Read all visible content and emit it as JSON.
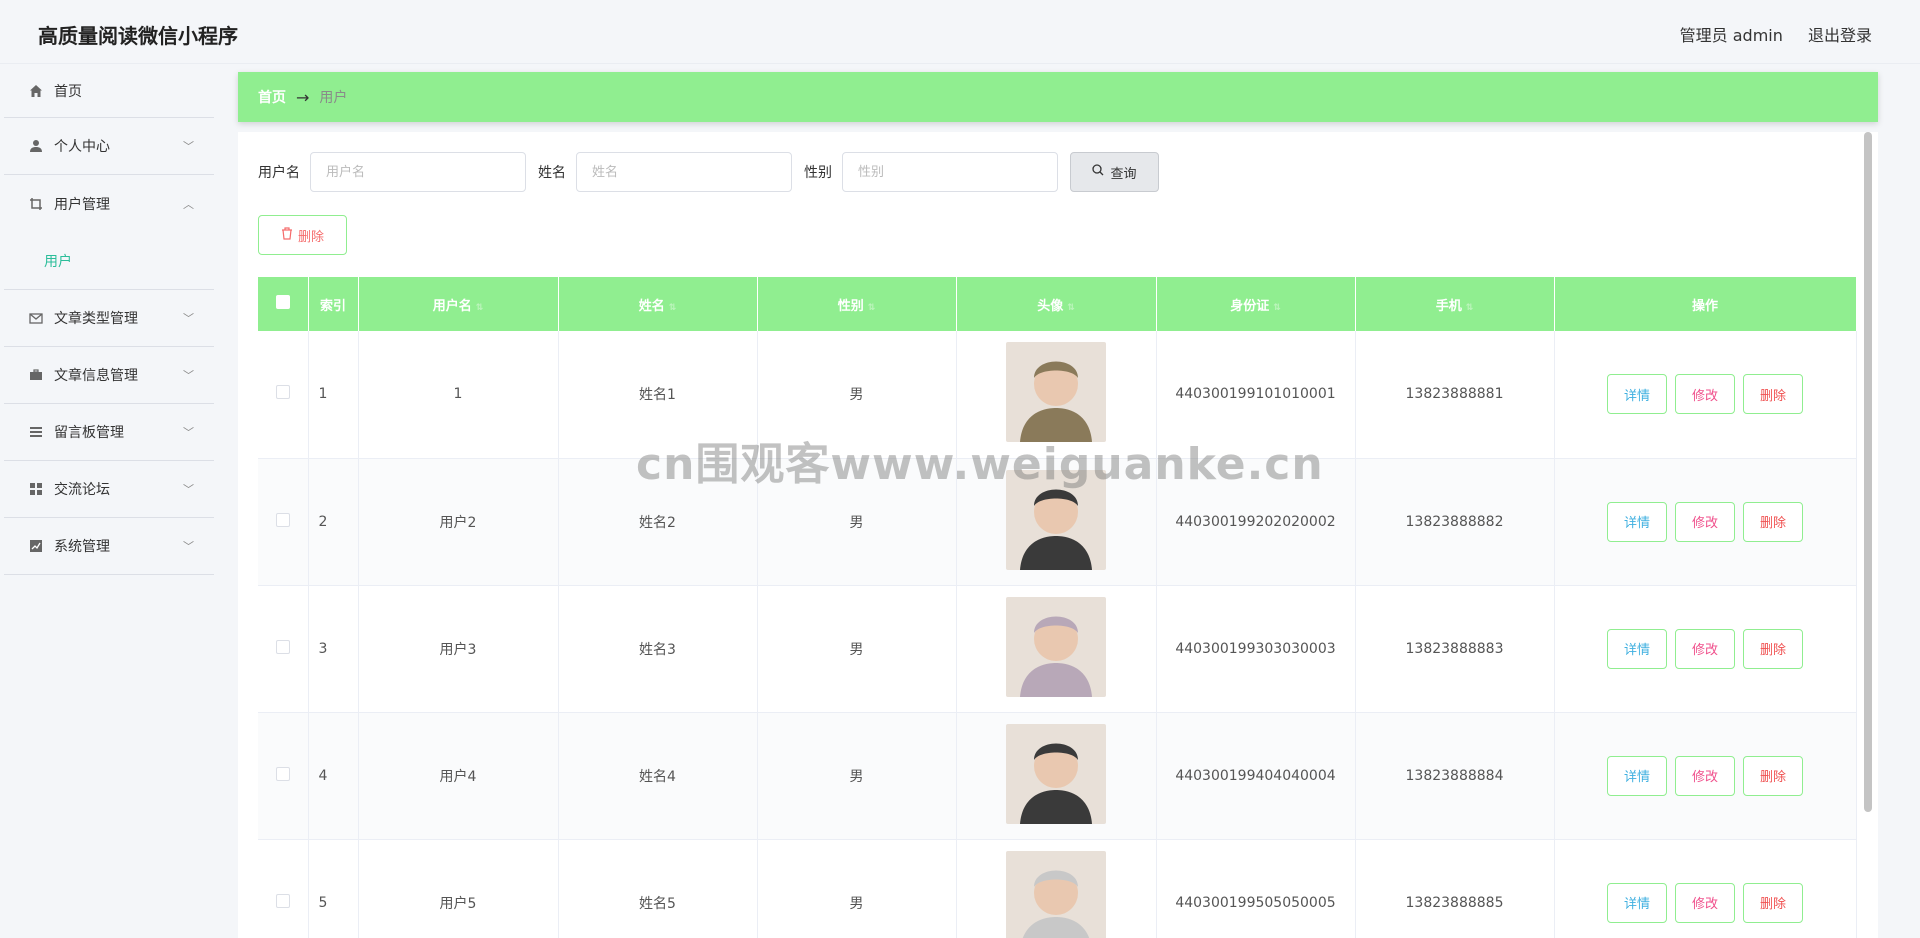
{
  "header": {
    "app_title": "高质量阅读微信小程序",
    "user": "管理员 admin",
    "logout": "退出登录"
  },
  "sidebar": {
    "items": [
      {
        "label": "首页",
        "icon": "home-icon"
      },
      {
        "label": "个人中心",
        "icon": "user-icon"
      },
      {
        "label": "用户管理",
        "icon": "crop-icon",
        "expanded": true,
        "children": [
          "用户"
        ]
      },
      {
        "label": "文章类型管理",
        "icon": "mail-icon"
      },
      {
        "label": "文章信息管理",
        "icon": "briefcase-icon"
      },
      {
        "label": "留言板管理",
        "icon": "list-icon"
      },
      {
        "label": "交流论坛",
        "icon": "grid-icon"
      },
      {
        "label": "系统管理",
        "icon": "chart-icon"
      }
    ]
  },
  "breadcrumb": {
    "home": "首页",
    "current": "用户"
  },
  "search": {
    "username_label": "用户名",
    "username_placeholder": "用户名",
    "name_label": "姓名",
    "name_placeholder": "姓名",
    "gender_label": "性别",
    "gender_placeholder": "性别",
    "query_button": "查询"
  },
  "actions": {
    "delete_button": "删除"
  },
  "table": {
    "headers": [
      "索引",
      "用户名",
      "姓名",
      "性别",
      "头像",
      "身份证",
      "手机",
      "操作"
    ],
    "op_labels": {
      "detail": "详情",
      "edit": "修改",
      "delete": "删除"
    },
    "rows": [
      {
        "index": "1",
        "username": "1",
        "name": "姓名1",
        "gender": "男",
        "id_card": "440300199101010001",
        "phone": "13823888881",
        "avatar_color": "#8a7a5a"
      },
      {
        "index": "2",
        "username": "用户2",
        "name": "姓名2",
        "gender": "男",
        "id_card": "440300199202020002",
        "phone": "13823888882",
        "avatar_color": "#3a3a3a"
      },
      {
        "index": "3",
        "username": "用户3",
        "name": "姓名3",
        "gender": "男",
        "id_card": "440300199303030003",
        "phone": "13823888883",
        "avatar_color": "#b8a8b8"
      },
      {
        "index": "4",
        "username": "用户4",
        "name": "姓名4",
        "gender": "男",
        "id_card": "440300199404040004",
        "phone": "13823888884",
        "avatar_color": "#3a3a3a"
      },
      {
        "index": "5",
        "username": "用户5",
        "name": "姓名5",
        "gender": "男",
        "id_card": "440300199505050005",
        "phone": "13823888885",
        "avatar_color": "#c8c8c8"
      }
    ]
  },
  "watermark": "cn围观客www.weiguanke.cn",
  "colors": {
    "accent": "#90ee90",
    "submenu_active": "#2bbd9a",
    "danger": "#f56c6c"
  }
}
